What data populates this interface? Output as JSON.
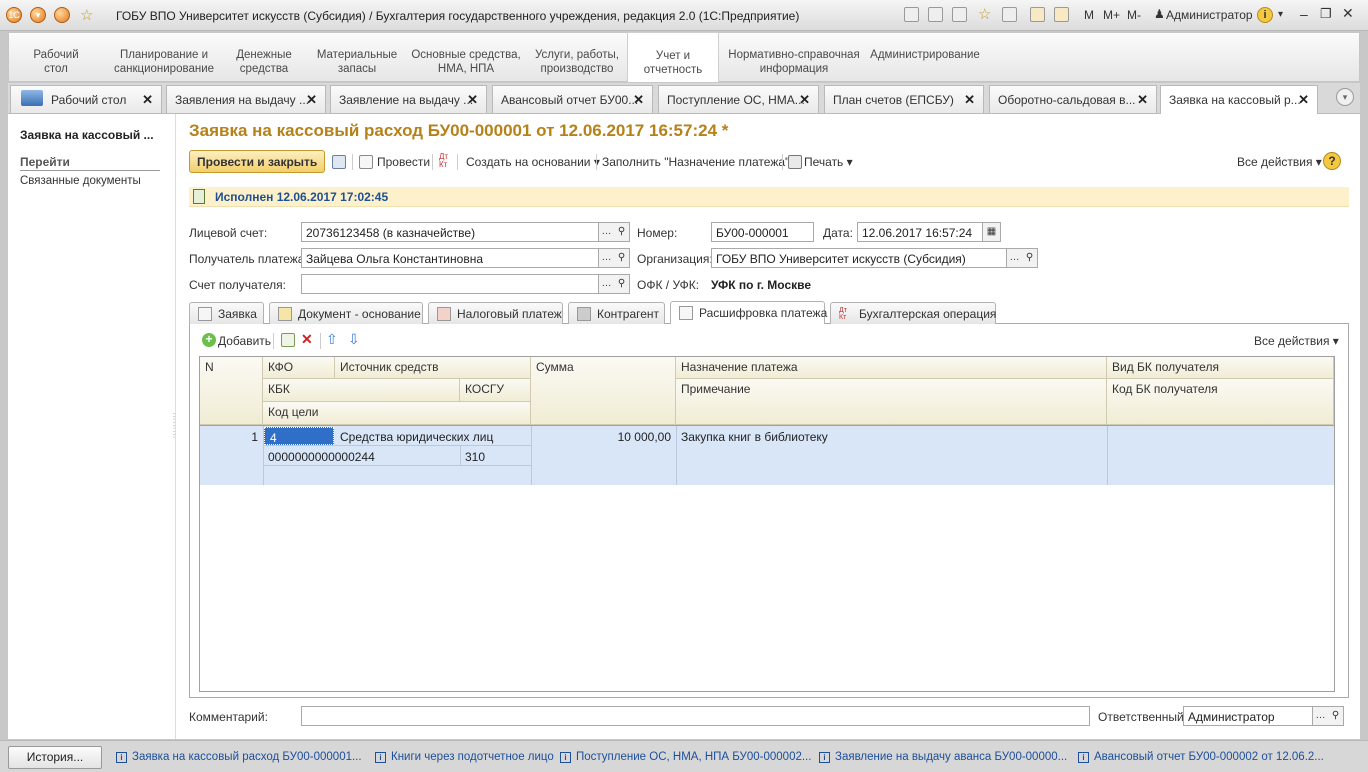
{
  "window": {
    "title": "ГОБУ ВПО Университет искусств (Субсидия) / Бухгалтерия государственного учреждения, редакция 2.0  (1С:Предприятие)",
    "memory_buttons": [
      "M",
      "M+",
      "M-"
    ],
    "user": "Администратор"
  },
  "sections": [
    {
      "line1": "Рабочий",
      "line2": "стол"
    },
    {
      "line1": "Планирование и",
      "line2": "санкционирование"
    },
    {
      "line1": "Денежные",
      "line2": "средства"
    },
    {
      "line1": "Материальные",
      "line2": "запасы"
    },
    {
      "line1": "Основные средства,",
      "line2": "НМА, НПА"
    },
    {
      "line1": "Услуги, работы,",
      "line2": "производство"
    },
    {
      "line1": "Учет и",
      "line2": "отчетность"
    },
    {
      "line1": "Нормативно-справочная",
      "line2": "информация"
    },
    {
      "line1": "Администрирование",
      "line2": ""
    }
  ],
  "open_tabs": [
    "Рабочий стол",
    "Заявления на выдачу ...",
    "Заявление на выдачу ...",
    "Авансовый отчет БУ00...",
    "Поступление ОС, НМА...",
    "План счетов (ЕПСБУ)",
    "Оборотно-сальдовая в...",
    "Заявка на кассовый р..."
  ],
  "left_panel": {
    "title": "Заявка на кассовый ...",
    "goto": "Перейти",
    "related": "Связанные документы"
  },
  "document": {
    "title": "Заявка на кассовый расход БУ00-000001 от 12.06.2017 16:57:24 *",
    "status": "Исполнен 12.06.2017 17:02:45"
  },
  "commands": {
    "post_close": "Провести и закрыть",
    "post": "Провести",
    "create_based": "Создать на основании",
    "fill_purpose": "Заполнить \"Назначение платежа\"",
    "print": "Печать",
    "all_actions": "Все действия",
    "help": "?"
  },
  "form": {
    "account_label": "Лицевой счет:",
    "account_value": "20736123458 (в казначействе)",
    "number_label": "Номер:",
    "number_value": "БУ00-000001",
    "date_label": "Дата:",
    "date_value": "12.06.2017 16:57:24",
    "payee_label": "Получатель платежа:",
    "payee_value": "Зайцева Ольга Константиновна",
    "org_label": "Организация:",
    "org_value": "ГОБУ ВПО Университет искусств (Субсидия)",
    "payee_account_label": "Счет получателя:",
    "payee_account_value": "",
    "ofk_label": "ОФК / УФК:",
    "ofk_value": "УФК по г. Москве",
    "comment_label": "Комментарий:",
    "comment_value": "",
    "responsible_label": "Ответственный:",
    "responsible_value": "Администратор"
  },
  "subtabs": [
    "Заявка",
    "Документ - основание",
    "Налоговый платеж",
    "Контрагент",
    "Расшифровка платежа",
    "Бухгалтерская операция"
  ],
  "table_toolbar": {
    "add": "Добавить",
    "all_actions": "Все действия"
  },
  "table": {
    "headers": {
      "n": "N",
      "kfo": "КФО",
      "source": "Источник средств",
      "sum": "Сумма",
      "purpose": "Назначение платежа",
      "bk_type": "Вид БК получателя",
      "kbk": "КБК",
      "kosgu": "КОСГУ",
      "note": "Примечание",
      "bk_code": "Код БК получателя",
      "target_code": "Код цели"
    },
    "rows": [
      {
        "n": "1",
        "kfo": "4",
        "source": "Средства юридических лиц",
        "sum": "10 000,00",
        "purpose": "Закупка книг в библиотеку",
        "kbk": "0000000000000244",
        "kosgu": "310"
      }
    ]
  },
  "taskbar": {
    "history": "История...",
    "items": [
      "Заявка на кассовый расход БУ00-000001...",
      "Книги через подотчетное лицо",
      "Поступление ОС, НМА, НПА БУ00-000002...",
      "Заявление на выдачу аванса БУ00-00000...",
      "Авансовый отчет БУ00-000002 от 12.06.2..."
    ]
  },
  "colors": {
    "title_accent": "#b5821a",
    "status_bg": "#fdf1cc",
    "status_text": "#1e4f8f",
    "row_selected": "#d8e6f8",
    "primary_button": "#f2cf6a"
  }
}
